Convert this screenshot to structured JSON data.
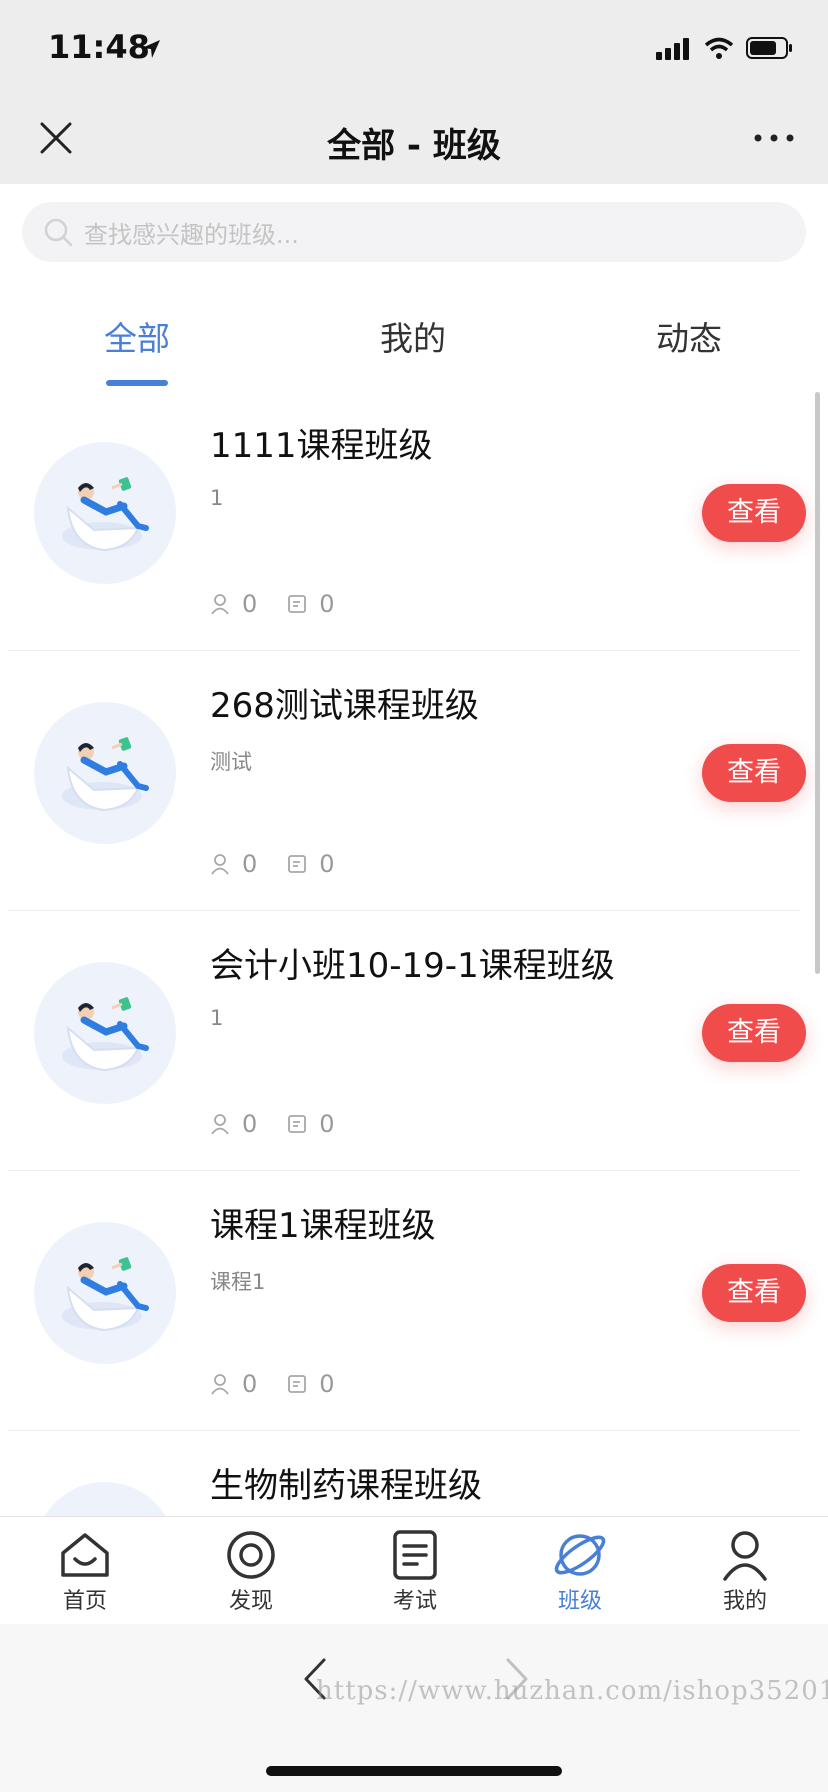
{
  "status_bar": {
    "time": "11:48"
  },
  "nav": {
    "title": "全部 - 班级"
  },
  "search": {
    "placeholder": "查找感兴趣的班级..."
  },
  "tabs": [
    {
      "label": "全部",
      "active": true
    },
    {
      "label": "我的",
      "active": false
    },
    {
      "label": "动态",
      "active": false
    }
  ],
  "classes": [
    {
      "title": "1111课程班级",
      "desc": "1",
      "members": "0",
      "posts": "0",
      "button": "查看"
    },
    {
      "title": "268测试课程班级",
      "desc": "测试",
      "members": "0",
      "posts": "0",
      "button": "查看"
    },
    {
      "title": "会计小班10-19-1课程班级",
      "desc": "1",
      "members": "0",
      "posts": "0",
      "button": "查看"
    },
    {
      "title": "课程1课程班级",
      "desc": "课程1",
      "members": "0",
      "posts": "0",
      "button": "查看"
    },
    {
      "title": "生物制药课程班级",
      "desc": "",
      "members": "",
      "posts": "",
      "button": ""
    }
  ],
  "tabbar": [
    {
      "label": "首页",
      "icon": "home-icon"
    },
    {
      "label": "发现",
      "icon": "discover-icon"
    },
    {
      "label": "考试",
      "icon": "exam-icon"
    },
    {
      "label": "班级",
      "icon": "class-planet-icon",
      "active": true
    },
    {
      "label": "我的",
      "icon": "profile-icon"
    }
  ],
  "watermark": "https://www.huzhan.com/ishop35201",
  "colors": {
    "accent": "#4a7fd6",
    "button": "#f04c4c"
  }
}
